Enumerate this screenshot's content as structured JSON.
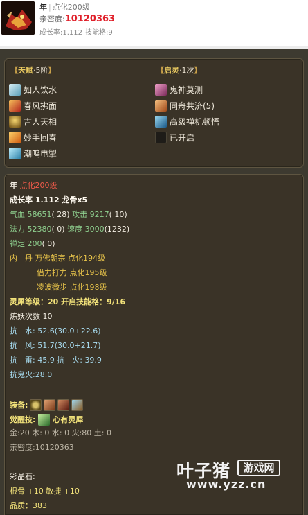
{
  "header": {
    "name": "年",
    "level_tag": "点化200级",
    "intimacy_label": "亲密度:",
    "intimacy_value": "10120363",
    "growth_label": "成长率:1.112",
    "skill_slots_label": "技能格:9"
  },
  "talent": {
    "left_bracket": "【",
    "right_bracket": "】",
    "title": "天赋",
    "dot": "·",
    "tier": "5阶",
    "skills": [
      {
        "label": "如人饮水",
        "icon": "water-drink-icon",
        "color": "#7fb7c9"
      },
      {
        "label": "春风拂面",
        "icon": "spring-wind-icon",
        "color": "#d0562a"
      },
      {
        "label": "吉人天相",
        "icon": "fortune-icon",
        "color": "#c89a2a"
      },
      {
        "label": "妙手回春",
        "icon": "healing-hand-icon",
        "color": "#e08a20"
      },
      {
        "label": "潮鸣电掣",
        "icon": "tide-thunder-icon",
        "color": "#4ab0c8"
      }
    ]
  },
  "spirit": {
    "left_bracket": "【",
    "right_bracket": "】",
    "title": "启灵",
    "dot": "·",
    "count": "1次",
    "skills": [
      {
        "label": "鬼神莫测",
        "icon": "ghost-mystery-icon",
        "color": "#c8608a"
      },
      {
        "label": "同舟共济(5)",
        "icon": "same-boat-icon",
        "color": "#d07a3a"
      },
      {
        "label": "高级禅机顿悟",
        "icon": "zen-insight-icon",
        "color": "#3a8ab0"
      },
      {
        "label": "已开启",
        "icon": "locked-slot-icon",
        "color": "#2a2a2a"
      }
    ]
  },
  "attrs": {
    "name": "年",
    "level": "点化200级",
    "growth": "成长率 1.112 龙骨x5",
    "hp_label": "气血",
    "hp_value": "58651",
    "hp_bonus": "( 28)",
    "atk_label": "攻击",
    "atk_value": "9217",
    "atk_bonus": "( 10)",
    "mp_label": "法力",
    "mp_value": "52380",
    "mp_bonus": "( 0)",
    "spd_label": "速度",
    "spd_value": "3000",
    "spd_bonus": "(1232)",
    "focus_label": "禅定",
    "focus_value": "200",
    "focus_bonus": "( 0)",
    "inner_label": "内　丹",
    "inner_1": "万佛朝宗 点化194级",
    "inner_2": "借力打力 点化195级",
    "inner_3": "凌波微步 点化198级",
    "spirit_level": "灵犀等级：20 开启技能格：9/16",
    "demon_count": "炼妖次数 10",
    "resist_water_label": "抗　水:",
    "resist_water_value": "52.6(30.0+22.6)",
    "resist_wind_label": "抗　风:",
    "resist_wind_value": "51.7(30.0+21.7)",
    "resist_thunder_label": "抗　雷:",
    "resist_thunder_value": "45.9",
    "resist_fire_label": "抗　火:",
    "resist_fire_value": "39.9",
    "resist_ghostfire_label": "抗鬼火:",
    "resist_ghostfire_value": "28.0",
    "equip_label": "装备:",
    "equip_icons": [
      "ring-icon",
      "armor-icon",
      "bracer-icon",
      "wing-icon"
    ],
    "awake_label": "觉醒技:",
    "awake_skill": "心有灵犀",
    "elements": "金:20 木: 0 水: 0 火:80 土: 0",
    "intimacy": "亲密度:10120363",
    "crystal_label": "彩晶石:",
    "crystal_value": "根骨 +10 敏捷 +10",
    "quality": "品质：383"
  },
  "watermark": {
    "cn": "叶子猪",
    "box": "游戏网",
    "url": "www.yzz.cn"
  }
}
